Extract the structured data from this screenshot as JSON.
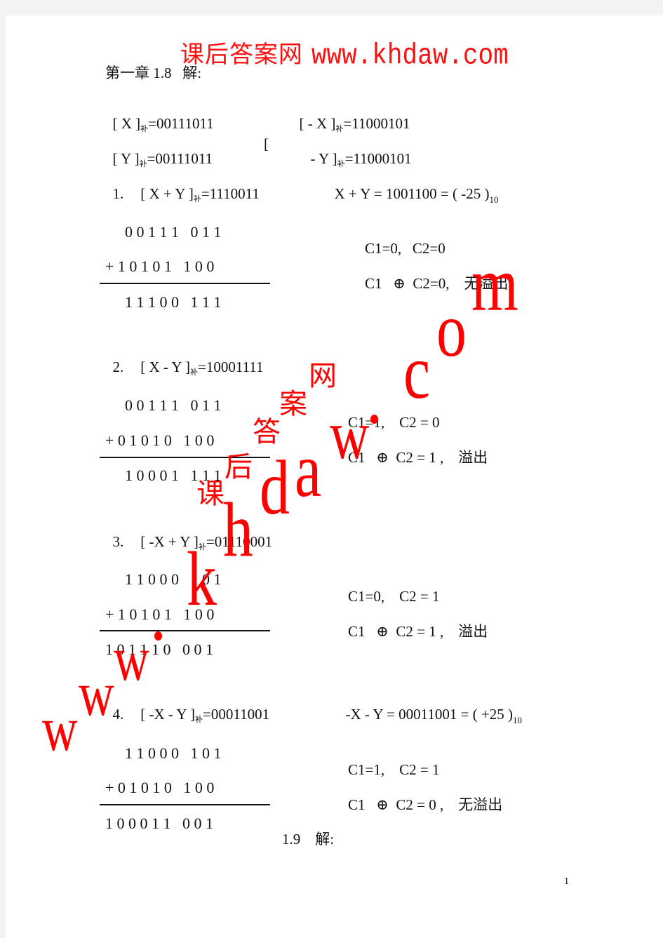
{
  "header": {
    "site_name_cn": "课后答案网",
    "site_url": "www.khdaw.com"
  },
  "chapter_title": "第一章 1.8   解:",
  "defs": {
    "x": {
      "label": "[ X ]",
      "sub": "补",
      "value": "=00111011"
    },
    "neg_x": {
      "label": "[ - X ]",
      "sub": "补",
      "value": "=11000101"
    },
    "y": {
      "label": "[ Y ]",
      "sub": "补",
      "value": "=00111011"
    },
    "neg_y_bracket": "[",
    "neg_y": {
      "label": "- Y ]",
      "sub": "补",
      "value": "=11000101"
    }
  },
  "problems": [
    {
      "num": "1.",
      "expr": "[ X + Y ]",
      "sub": "补",
      "value": "=1110011",
      "extra": "X + Y = 1001100 = ( -25 )",
      "extra_sub": "10",
      "addend1": "0 0 1 1 1   0 1 1",
      "addend2": "+ 1 0 1 0 1   1 0 0",
      "result": "1 1 1 0 0   1 1 1",
      "carry": "C1=0,   C2=0",
      "xor": "C1   ⊕  C2=0,    无溢出"
    },
    {
      "num": "2.",
      "expr": "[ X - Y ]",
      "sub": "补",
      "value": "=10001111",
      "extra": "",
      "extra_sub": "",
      "addend1": "0 0 1 1 1   0 1 1",
      "addend2": "+ 0 1 0 1 0   1 0 0",
      "result": "1 0 0 0 1   1 1 1",
      "carry": "C1=1,    C2 = 0",
      "xor": "C1   ⊕  C2 = 1 ,    溢出"
    },
    {
      "num": "3.",
      "expr": "[ -X + Y ]",
      "sub": "补",
      "value": "=01110001",
      "extra": "",
      "extra_sub": "",
      "addend1": "1 1 0 0 0   1 0 1",
      "addend2": "+ 1 0 1 0 1   1 0 0",
      "result": "1 0 1 1 1 0   0 0 1",
      "carry": "C1=0,    C2 = 1",
      "xor": "C1   ⊕  C2 = 1 ,    溢出"
    },
    {
      "num": "4.",
      "expr": "[ -X - Y ]",
      "sub": "补",
      "value": "=00011001",
      "extra": "-X - Y = 00011001 = ( +25 )",
      "extra_sub": "10",
      "addend1": "1 1 0 0 0   1 0 1",
      "addend2": "+ 0 1 0 1 0   1 0 0",
      "result": "1 0 0 0 1 1   0 0 1",
      "carry": "C1=1,    C2 = 1",
      "xor": "C1   ⊕  C2 = 0 ,    无溢出"
    }
  ],
  "next_section": "1.9    解:",
  "page_number": "1",
  "watermark": {
    "chars_cn": [
      "课",
      "后",
      "答",
      "案",
      "网"
    ],
    "chars_latin": [
      "w",
      "w",
      "w",
      "k",
      "h",
      "d",
      "a",
      "w",
      "c",
      "o",
      "m"
    ],
    "color": "#ff0000"
  }
}
